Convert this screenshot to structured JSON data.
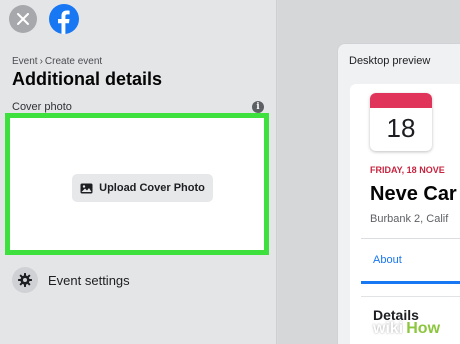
{
  "header": {
    "close_icon": "close-icon",
    "logo_icon": "facebook-logo-icon"
  },
  "breadcrumb": {
    "parent": "Event",
    "separator": "›",
    "current": "Create event"
  },
  "page_title": "Additional details",
  "cover": {
    "label": "Cover photo",
    "info_icon": "info-icon",
    "info_glyph": "i",
    "upload_label": "Upload Cover Photo",
    "upload_icon": "image-icon",
    "highlight_color": "#3ee03e"
  },
  "settings": {
    "label": "Event settings",
    "icon": "gear-icon"
  },
  "preview": {
    "title": "Desktop preview",
    "calendar_day": "18",
    "date": "FRIDAY, 18 NOVE",
    "event_name": "Neve Car",
    "location": "Burbank 2, Calif",
    "tab_about": "About",
    "details_title": "Details"
  },
  "watermark": {
    "wiki": "wiki",
    "how": "How"
  },
  "colors": {
    "accent": "#1877f2",
    "calendar_red": "#e1345a",
    "date_red": "#c7243f"
  }
}
